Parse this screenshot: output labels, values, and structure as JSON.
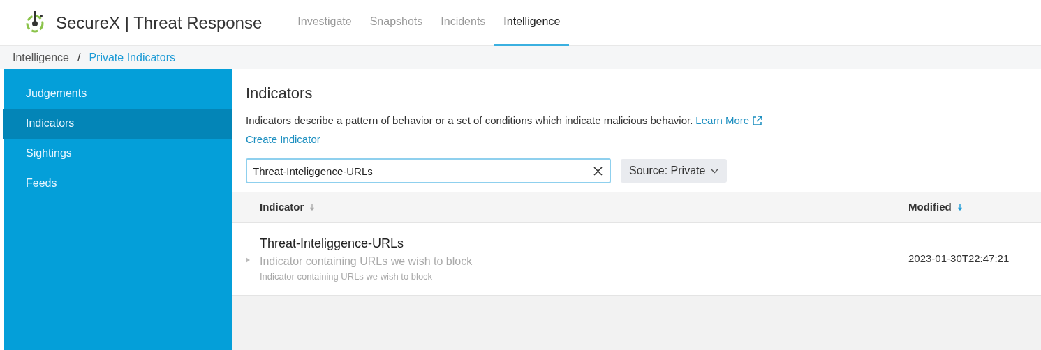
{
  "app": {
    "brand": "SecureX",
    "separator": "|",
    "product": "Threat Response"
  },
  "nav_tabs": [
    {
      "label": "Investigate",
      "selected": false
    },
    {
      "label": "Snapshots",
      "selected": false
    },
    {
      "label": "Incidents",
      "selected": false
    },
    {
      "label": "Intelligence",
      "selected": true
    }
  ],
  "breadcrumb": [
    {
      "label": "Intelligence",
      "kind": "plain"
    },
    {
      "label": "/",
      "kind": "separator"
    },
    {
      "label": "Private Indicators",
      "kind": "link"
    }
  ],
  "sidebar": {
    "items": [
      {
        "label": "Judgements",
        "selected": false
      },
      {
        "label": "Indicators",
        "selected": true
      },
      {
        "label": "Sightings",
        "selected": false
      },
      {
        "label": "Feeds",
        "selected": false
      }
    ]
  },
  "page": {
    "title": "Indicators",
    "description": "Indicators describe a pattern of behavior or a set of conditions which indicate malicious behavior.",
    "learn_more": "Learn More",
    "create_link": "Create Indicator"
  },
  "search": {
    "value": "Threat-Inteliggence-URLs"
  },
  "source_filter": {
    "label": "Source: Private"
  },
  "table": {
    "columns": [
      {
        "label": "Indicator",
        "sort_active": false
      },
      {
        "label": "Modified",
        "sort_active": true
      }
    ],
    "rows": [
      {
        "title": "Threat-Inteliggence-URLs",
        "description": "Indicator containing URLs we wish to block",
        "short_description": "Indicator containing URLs we wish to block",
        "modified": "2023-01-30T22:47:21",
        "expanded": false
      }
    ]
  }
}
